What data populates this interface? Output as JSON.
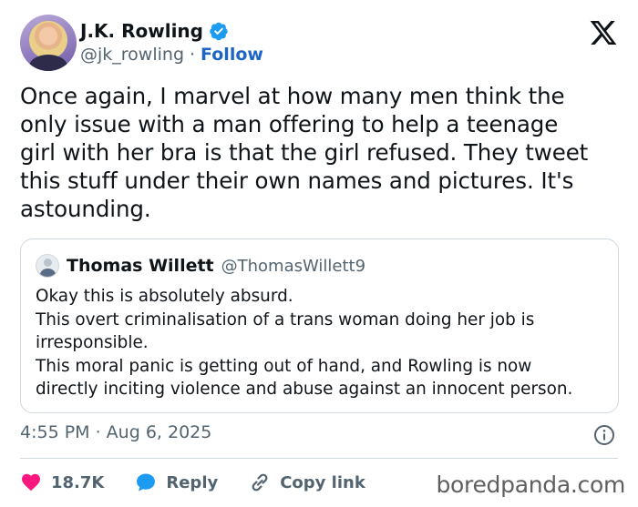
{
  "author": {
    "name": "J.K. Rowling",
    "handle": "@jk_rowling",
    "separator": "·",
    "follow_label": "Follow"
  },
  "tweet": {
    "text": "Once again, I marvel at how many men think the\nonly issue with a man offering to help a teenage\ngirl with her bra is that the girl refused. They tweet\nthis stuff under their own names and pictures. It's\nastounding.",
    "timestamp": "4:55 PM · Aug 6, 2025"
  },
  "quoted_tweet": {
    "name": "Thomas Willett",
    "handle": "@ThomasWillett9",
    "text": "Okay this is absolutely absurd.\nThis overt criminalisation of a trans woman doing her job is\nirresponsible.\nThis moral panic is getting out of hand, and Rowling is now\ndirectly inciting violence and abuse against an innocent person."
  },
  "actions": {
    "like_count": "18.7K",
    "reply_label": "Reply",
    "copy_link_label": "Copy link"
  },
  "watermark": "boredpanda.com",
  "colors": {
    "verified": "#1d9bf0",
    "follow": "#1d64c9",
    "heart": "#f91880",
    "reply": "#1d9bf0"
  },
  "icons": [
    "verified-badge-icon",
    "x-logo-icon",
    "info-icon",
    "heart-icon",
    "reply-bubble-icon",
    "link-icon"
  ]
}
